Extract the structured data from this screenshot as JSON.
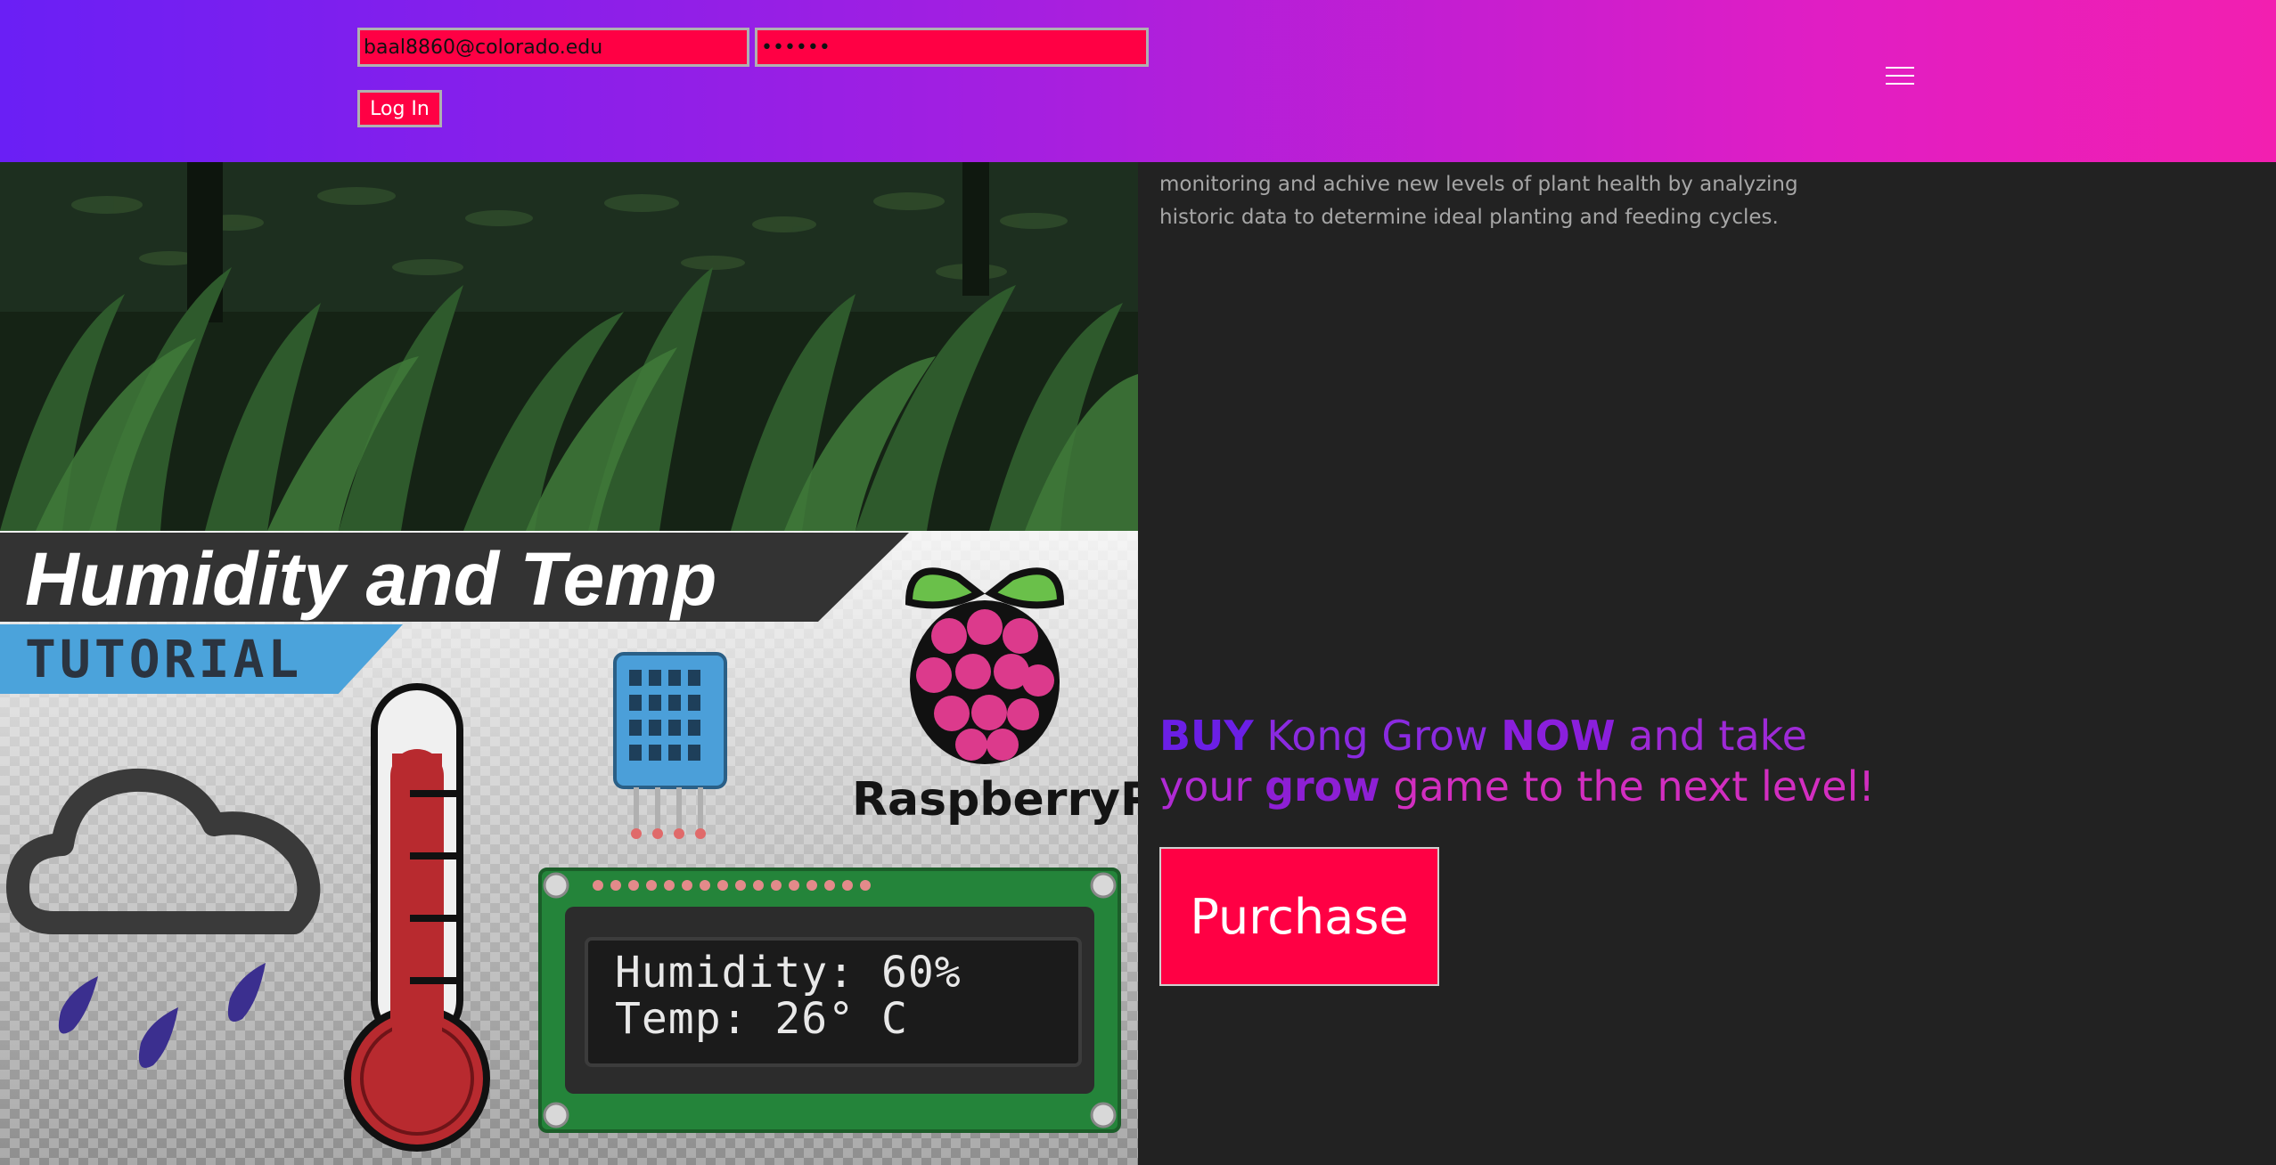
{
  "header": {
    "email_value": "baal8860@colorado.edu",
    "password_value": "••••••",
    "login_label": "Log In",
    "menu_icon": "hamburger-menu-icon"
  },
  "intro": {
    "text": "ideal temperature and humidity levels again with constant monitoring and achive new levels of plant health by analyzing historic data to determine ideal planting and feeding cycles."
  },
  "tutorial_image": {
    "title": "Humidity and Temp",
    "subtitle": "TUTORIAL",
    "brand": "RaspberryPi",
    "lcd_line1": "Humidity: 60%",
    "lcd_line2": "Temp: 26° C"
  },
  "cta": {
    "buy": "BUY",
    "kong_grow": " Kong Grow ",
    "now": "NOW",
    "and_take": " and take",
    "your": "your ",
    "grow": "grow",
    "rest": " game to the next level!"
  },
  "purchase_label": "Purchase",
  "colors": {
    "accent": "#ff0044",
    "header_gradient_start": "#6a1ff5",
    "header_gradient_end": "#f21fb0",
    "background": "#222222"
  }
}
